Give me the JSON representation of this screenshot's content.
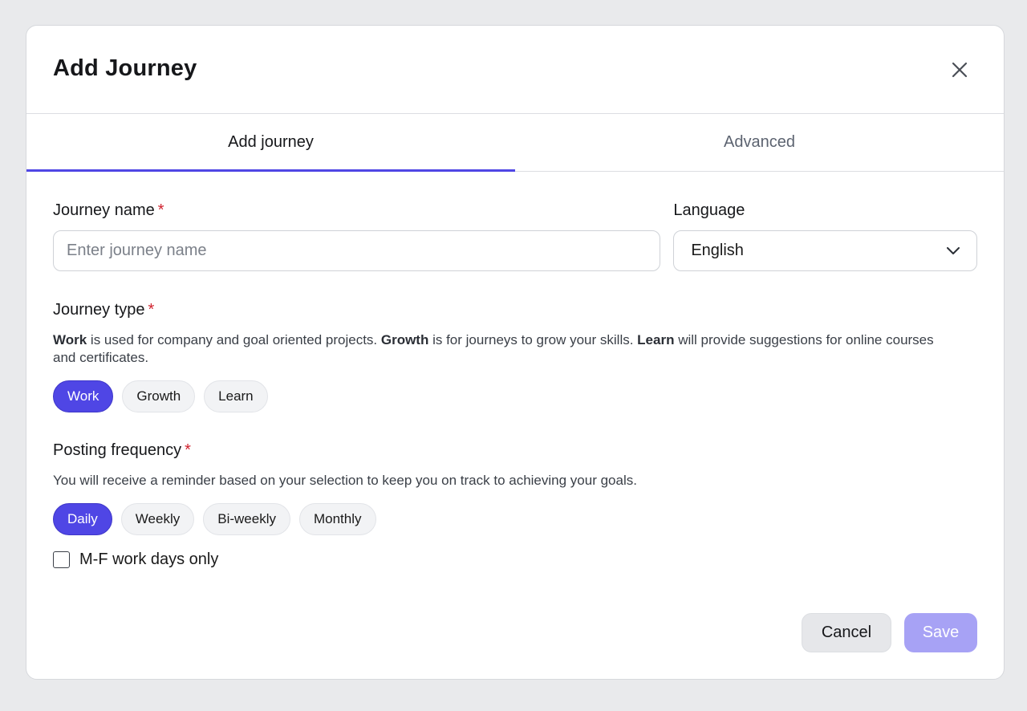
{
  "modal": {
    "title": "Add Journey",
    "close_icon": "close-icon"
  },
  "tabs": [
    {
      "label": "Add journey",
      "active": true
    },
    {
      "label": "Advanced",
      "active": false
    }
  ],
  "journey_name": {
    "label": "Journey name",
    "required_mark": "*",
    "value": "",
    "placeholder": "Enter journey name"
  },
  "language": {
    "label": "Language",
    "selected": "English",
    "icon": "chevron-down-icon"
  },
  "journey_type": {
    "label": "Journey type",
    "required_mark": "*",
    "desc": {
      "t1": "Work",
      "t2": " is used for company and goal oriented projects. ",
      "t3": "Growth",
      "t4": " is for journeys to grow your skills. ",
      "t5": "Learn",
      "t6": " will provide suggestions for online courses and certificates."
    },
    "options": [
      "Work",
      "Growth",
      "Learn"
    ],
    "selected": "Work"
  },
  "posting_frequency": {
    "label": "Posting frequency",
    "required_mark": "*",
    "desc": "You will receive a reminder based on your selection to keep you on track to achieving your goals.",
    "options": [
      "Daily",
      "Weekly",
      "Bi-weekly",
      "Monthly"
    ],
    "selected": "Daily",
    "checkbox_label": "M-F work days only",
    "checkbox_checked": false
  },
  "footer": {
    "cancel_label": "Cancel",
    "save_label": "Save"
  },
  "colors": {
    "accent": "#4f46e5",
    "save_disabled": "#a7a2f5",
    "required": "#d0222e"
  }
}
